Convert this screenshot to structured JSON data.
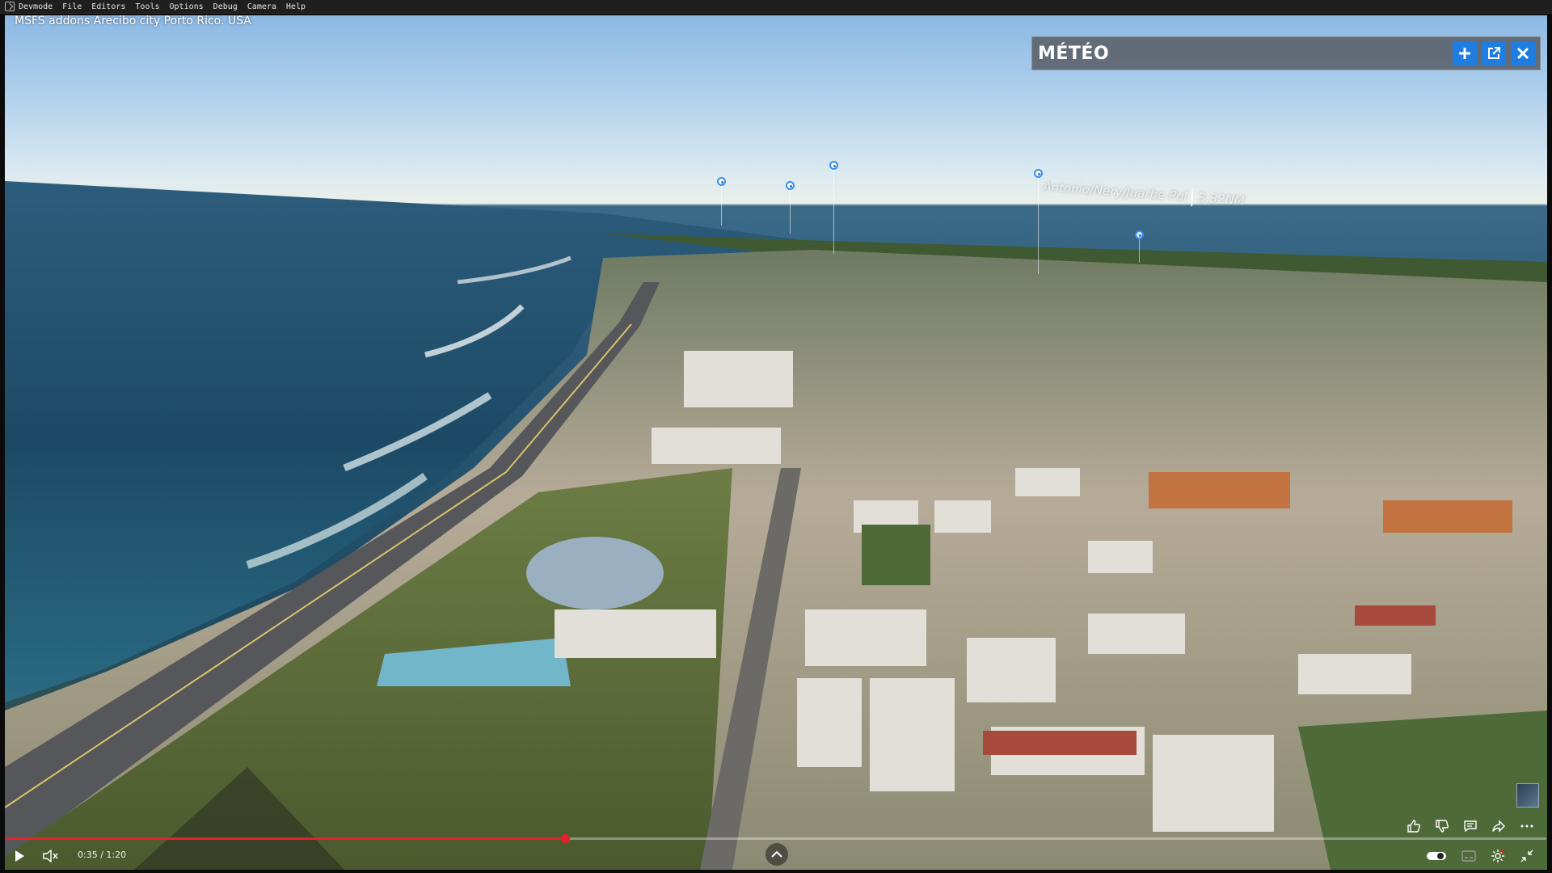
{
  "menubar": {
    "items": [
      "Devmode",
      "File",
      "Editors",
      "Tools",
      "Options",
      "Debug",
      "Camera",
      "Help"
    ]
  },
  "scene": {
    "title": "MSFS addons Arecibo city Porto Rico. USA",
    "waypoint": {
      "name": "Antonio/Nery/Juarbe Pol",
      "distance": "3.32NM"
    }
  },
  "meteo_panel": {
    "title": "MÉTÉO",
    "buttons": [
      "plus-icon",
      "popout-icon",
      "close-icon"
    ],
    "accent": "#1e7de0"
  },
  "player": {
    "time": "0:35 / 1:20",
    "progress_percent": 36.3,
    "progress_color": "#e2222a"
  }
}
